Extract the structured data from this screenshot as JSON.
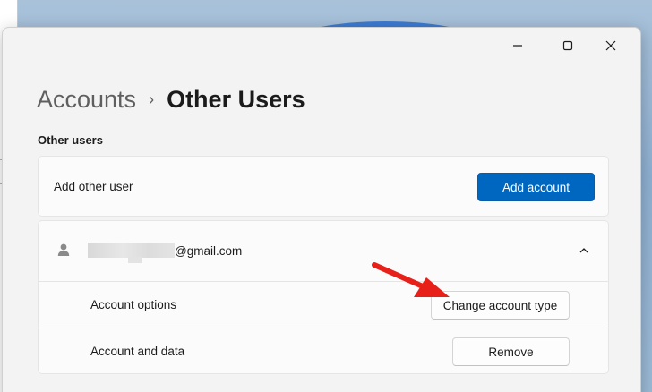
{
  "window": {
    "caption": {
      "minimize_icon": "minimize-icon",
      "maximize_icon": "maximize-icon",
      "close_icon": "close-icon"
    }
  },
  "breadcrumb": {
    "parent": "Accounts",
    "separator": "›",
    "current": "Other Users"
  },
  "other_users": {
    "section_title": "Other users",
    "add_other_user_label": "Add other user",
    "add_account_button": "Add account"
  },
  "user_card": {
    "icon": "person-icon",
    "email_suffix": "@gmail.com",
    "expanded": true,
    "options": [
      {
        "label": "Account options",
        "button": "Change account type"
      },
      {
        "label": "Account and data",
        "button": "Remove"
      }
    ]
  },
  "annotation": {
    "arrow_color": "#e8201a"
  },
  "colors": {
    "accent": "#0067c0",
    "window_bg": "#f3f3f3"
  }
}
